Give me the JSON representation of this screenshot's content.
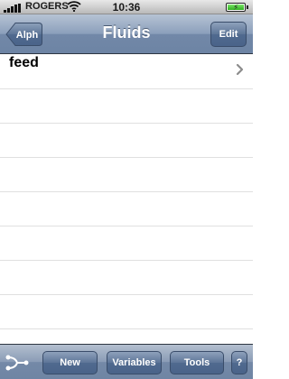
{
  "status_bar": {
    "carrier": "ROGERS",
    "time": "10:36"
  },
  "nav_bar": {
    "title": "Fluids",
    "back_label": "Alph",
    "edit_label": "Edit"
  },
  "list": {
    "items": [
      {
        "label": "feed"
      }
    ]
  },
  "toolbar": {
    "new_label": "New",
    "variables_label": "Variables",
    "tools_label": "Tools",
    "help_label": "?"
  },
  "colors": {
    "nav_bar": "#7288a8",
    "button": "#506a8f",
    "separator": "#e0e0e0"
  }
}
